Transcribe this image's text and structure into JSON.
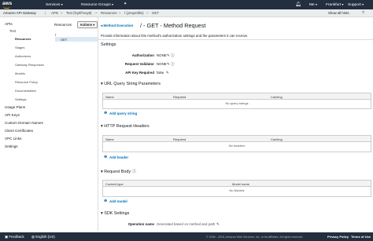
{
  "topnav": {
    "logo": "aws",
    "services": "Services",
    "resource_groups": "Resource Groups",
    "user": "Me",
    "region": "Frankfurt",
    "support": "Support"
  },
  "subnav": {
    "crumbs": [
      "Amazon API Gateway",
      "APIs",
      "Test (fxy8f7usy8)",
      "Resources",
      "/ (ymqvntlbs)",
      "GET"
    ],
    "show_hints": "Show all hints"
  },
  "sidebar": {
    "apis": "APIs",
    "api_name": "Test",
    "subitems": [
      "Resources",
      "Stages",
      "Authorizers",
      "Gateway Responses",
      "Models",
      "Resource Policy",
      "Documentation",
      "Settings"
    ],
    "sections": [
      "Usage Plans",
      "API Keys",
      "Custom Domain Names",
      "Client Certificates",
      "VPC Links",
      "Settings"
    ]
  },
  "resources_panel": {
    "title": "Resources",
    "actions": "Actions",
    "root": "/",
    "method": "GET"
  },
  "main": {
    "back_link": "Method Execution",
    "title": "/ - GET - Method Request",
    "description": "Provide information about this method's authorization settings and the parameters it can receive.",
    "settings_heading": "Settings",
    "settings": [
      {
        "label": "Authorization",
        "value": "NONE"
      },
      {
        "label": "Request Validator",
        "value": "NONE"
      },
      {
        "label": "API Key Required",
        "value": "false"
      }
    ],
    "query": {
      "heading": "URL Query String Parameters",
      "cols": [
        "Name",
        "Required",
        "Caching"
      ],
      "empty": "No query strings",
      "add": "Add query string"
    },
    "headers": {
      "heading": "HTTP Request Headers",
      "cols": [
        "Name",
        "Required",
        "Caching"
      ],
      "empty": "No headers",
      "add": "Add header"
    },
    "body": {
      "heading": "Request Body",
      "cols": [
        "Content type",
        "Model name"
      ],
      "empty": "No Models",
      "add": "Add model"
    },
    "sdk": {
      "heading": "SDK Settings",
      "op_label": "Operation name",
      "op_value": "Generated based on method and path"
    }
  },
  "footer": {
    "feedback": "Feedback",
    "language": "English (US)",
    "copyright": "© 2008 - 2018, Amazon Web Services, Inc. or its affiliates. All rights reserved.",
    "privacy": "Privacy Policy",
    "terms": "Terms of Use"
  }
}
